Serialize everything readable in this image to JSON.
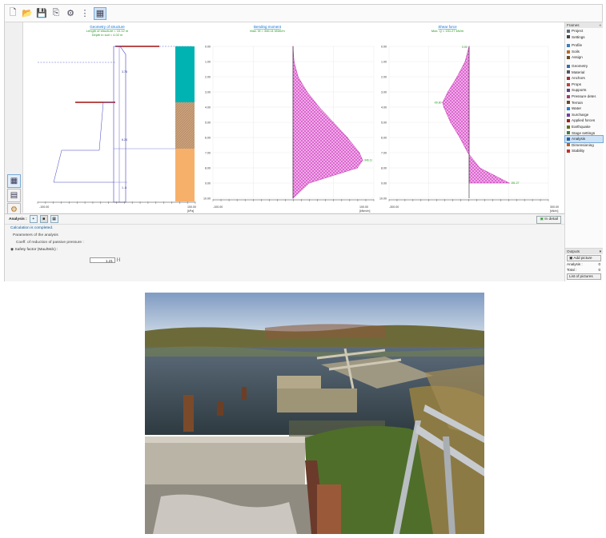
{
  "toolbar": {
    "icons": [
      "new-icon",
      "open-icon",
      "save-icon",
      "copy-icon",
      "settings-icon",
      "view-icon",
      "template-icon"
    ]
  },
  "charts": {
    "geometry": {
      "title": "Geometry of structure",
      "line1": "Length of structure = 10.12 m",
      "line2": "Depth in soil = 4.02 m",
      "labels": [
        "3.75",
        "6.24",
        "1..8"
      ],
      "axis_left": "-100.00",
      "axis_right": "100.00",
      "axis_unit": "[kPa]"
    },
    "moment": {
      "title": "Bending moment",
      "subtitle": "Max. M = 346.11 kNm/m",
      "max_label": "346.11",
      "axis_left": "-100.00",
      "axis_right": "100.00",
      "axis_unit": "[kNm/m]",
      "y_ticks": [
        "0.00",
        "1.00",
        "2.00",
        "3.00",
        "4.00",
        "5.00",
        "6.00",
        "7.00",
        "8.00",
        "9.00",
        "10.00"
      ]
    },
    "shear": {
      "title": "Shear force",
      "subtitle": "Max. Q = 151.27 kN/m",
      "top_label": "0.00",
      "mid_label": "-99.80",
      "max_label": "151.27",
      "axis_left": "-300.00",
      "axis_right": "300.00",
      "axis_unit": "[kN/m]",
      "y_ticks": [
        "0.00",
        "1.00",
        "2.00",
        "3.00",
        "4.00",
        "5.00",
        "6.00",
        "7.00",
        "8.00",
        "9.00",
        "10.00"
      ]
    }
  },
  "chart_data": [
    {
      "type": "area",
      "title": "Bending moment",
      "subtitle": "Max. M = 346.11 kNm/m",
      "x_unit": "[kNm/m]",
      "y": [
        0,
        1,
        2,
        3,
        4,
        5,
        6,
        7,
        7.5,
        8,
        9,
        10
      ],
      "values": [
        0,
        5,
        25,
        70,
        130,
        200,
        270,
        330,
        346.11,
        320,
        80,
        0
      ],
      "ylim": [
        0,
        10
      ],
      "grid": true
    },
    {
      "type": "area",
      "title": "Shear force",
      "subtitle": "Max. Q = 151.27 kN/m",
      "x_unit": "[kN/m]",
      "y": [
        0,
        1,
        2,
        3,
        3.7,
        4,
        5,
        6,
        7,
        8,
        9
      ],
      "values": [
        0,
        -15,
        -45,
        -80,
        -99.8,
        -95,
        -70,
        -35,
        -5,
        40,
        151.27
      ],
      "ylim": [
        0,
        10
      ],
      "grid": true
    }
  ],
  "frames": {
    "header": "Frames",
    "items": [
      {
        "label": "Project",
        "color": "#5a6b7c"
      },
      {
        "label": "Settings",
        "color": "#444"
      },
      {
        "sep": true
      },
      {
        "label": "Profile",
        "color": "#3a7fc0"
      },
      {
        "label": "Soils",
        "color": "#b36b2a"
      },
      {
        "label": "Assign",
        "color": "#6b4c2a"
      },
      {
        "sep": true
      },
      {
        "label": "Geometry",
        "color": "#3070b0"
      },
      {
        "label": "Material",
        "color": "#556"
      },
      {
        "label": "Anchors",
        "color": "#a03030"
      },
      {
        "label": "Props",
        "color": "#c04040"
      },
      {
        "label": "Supports",
        "color": "#604080"
      },
      {
        "label": "Pressure deter.",
        "color": "#a04070"
      },
      {
        "label": "Terrain",
        "color": "#6a4a2a"
      },
      {
        "label": "Water",
        "color": "#2a7fd0"
      },
      {
        "label": "Surcharge",
        "color": "#7040a0"
      },
      {
        "label": "Applied forces",
        "color": "#a02020"
      },
      {
        "label": "Earthquake",
        "color": "#607020"
      },
      {
        "label": "Stage settings",
        "color": "#408040"
      },
      {
        "label": "Analysis",
        "color": "#2a60a0",
        "selected": true
      },
      {
        "label": "Dimensioning",
        "color": "#c06020"
      },
      {
        "label": "Stability",
        "color": "#c03030"
      }
    ]
  },
  "outputs": {
    "header": "Outputs",
    "add_picture": "Add picture",
    "rows": [
      {
        "label": "Analysis :",
        "value": "0"
      },
      {
        "label": "Total :",
        "value": "0"
      }
    ],
    "list_button": "List of pictures"
  },
  "panel": {
    "title": "Analysis :",
    "in_detail": "In detail",
    "message": "Calculation is completed.",
    "group": "Parameters of the analysis",
    "coeff_label": "Coeff. of reduction of passive pressure :",
    "safety_label": "Safety factor (Mau/Mdc) :",
    "safety_value": "1.21",
    "safety_unit": "[-]"
  }
}
